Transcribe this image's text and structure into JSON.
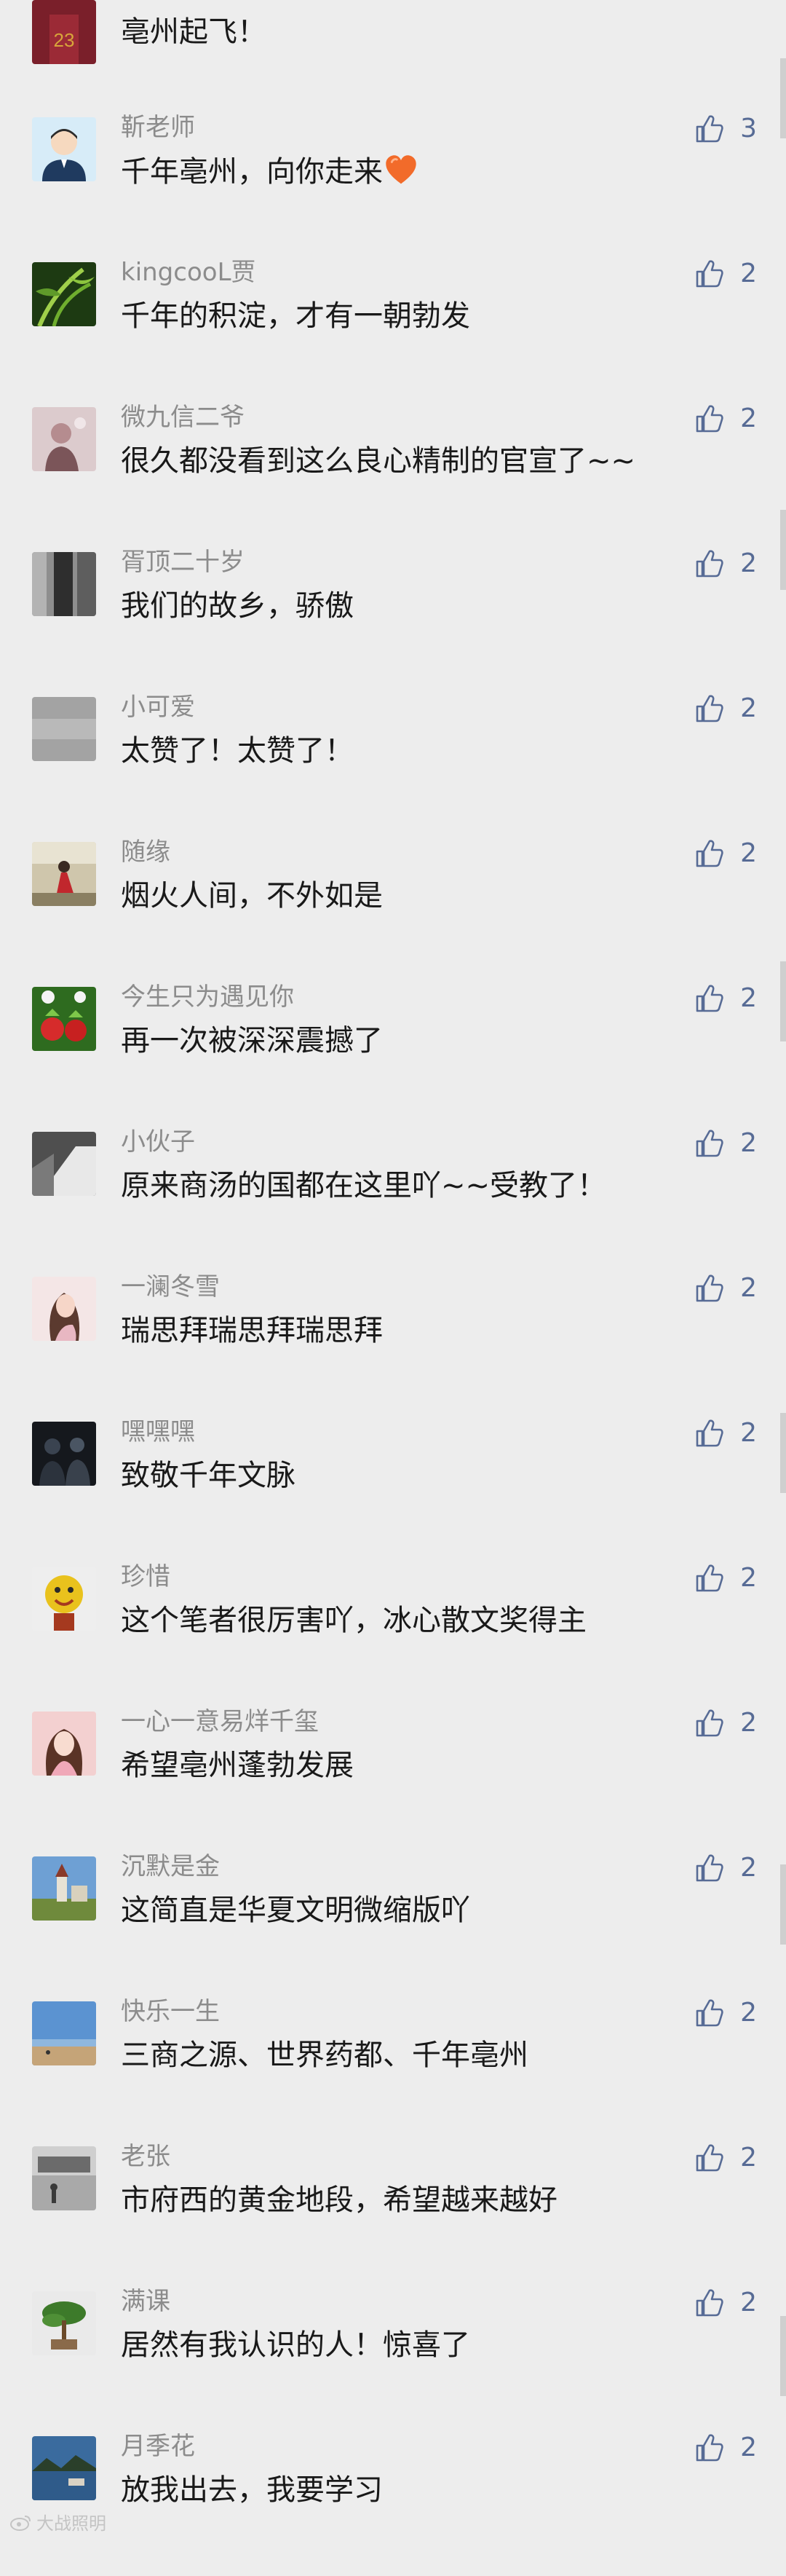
{
  "comments": [
    {
      "name": "",
      "text": "亳州起飞！",
      "likes": "",
      "avatar": "avatar-basketball-jersey",
      "colors": [
        "#7a1f2a",
        "#d8a53a"
      ]
    },
    {
      "name": "靳老师",
      "text": "千年亳州，向你走来",
      "emoji": "heart-emoji",
      "likes": "3",
      "avatar": "avatar-cartoon-teacher",
      "colors": [
        "#cfe6f4",
        "#1f3a5f"
      ]
    },
    {
      "name": "kingcooL贾",
      "text": "千年的积淀，才有一朝勃发",
      "likes": "2",
      "avatar": "avatar-bamboo",
      "colors": [
        "#2f5a1c",
        "#9fcf4a"
      ]
    },
    {
      "name": "微九信二爷",
      "text": "很久都没看到这么良心精制的官宣了~~",
      "likes": "2",
      "avatar": "avatar-pink-portrait",
      "colors": [
        "#d8c6c9",
        "#6f4a4f"
      ]
    },
    {
      "name": "胥顶二十岁",
      "text": "我们的故乡，骄傲",
      "likes": "2",
      "avatar": "avatar-dark-room",
      "colors": [
        "#3a3a3a",
        "#8e8e8e"
      ]
    },
    {
      "name": "小可爱",
      "text": "太赞了！太赞了！",
      "likes": "2",
      "avatar": "avatar-grey-blank",
      "colors": [
        "#9a9a9a",
        "#b5b5b5"
      ]
    },
    {
      "name": "随缘",
      "text": "烟火人间，不外如是",
      "likes": "2",
      "avatar": "avatar-red-dress",
      "colors": [
        "#c9c0a6",
        "#c1272d"
      ]
    },
    {
      "name": "今生只为遇见你",
      "text": "再一次被深深震撼了",
      "likes": "2",
      "avatar": "avatar-strawberries",
      "colors": [
        "#2e6b1f",
        "#d62b2b"
      ]
    },
    {
      "name": "小伙子",
      "text": "原来商汤的国都在这里吖~~受教了！",
      "likes": "2",
      "avatar": "avatar-light-window",
      "colors": [
        "#5a5a5a",
        "#e8e8e8"
      ]
    },
    {
      "name": "一澜冬雪",
      "text": "瑞思拜瑞思拜瑞思拜",
      "likes": "2",
      "avatar": "avatar-girl-portrait",
      "colors": [
        "#f1dede",
        "#5b3a2f"
      ]
    },
    {
      "name": "嘿嘿嘿",
      "text": "致敬千年文脉",
      "likes": "2",
      "avatar": "avatar-night-people",
      "colors": [
        "#15181d",
        "#4a5563"
      ]
    },
    {
      "name": "珍惜",
      "text": "这个笔者很厉害吖，冰心散文奖得主",
      "likes": "2",
      "avatar": "avatar-smiley-toy",
      "colors": [
        "#e9c21d",
        "#a5391f"
      ]
    },
    {
      "name": "一心一意易烊千玺",
      "text": "希望亳州蓬勃发展",
      "likes": "2",
      "avatar": "avatar-pink-girl",
      "colors": [
        "#f3c7c7",
        "#5a3326"
      ]
    },
    {
      "name": "沉默是金",
      "text": "这简直是华夏文明微缩版吖",
      "likes": "2",
      "avatar": "avatar-castle",
      "colors": [
        "#5e93c8",
        "#7a8f4a"
      ]
    },
    {
      "name": "快乐一生",
      "text": "三商之源、世界药都、千年亳州",
      "likes": "2",
      "avatar": "avatar-beach",
      "colors": [
        "#4f86c7",
        "#c5a478"
      ]
    },
    {
      "name": "老张",
      "text": "市府西的黄金地段，希望越来越好",
      "likes": "2",
      "avatar": "avatar-street-scene",
      "colors": [
        "#c7c7c7",
        "#6b6b6b"
      ]
    },
    {
      "name": "满课",
      "text": "居然有我认识的人！惊喜了",
      "likes": "2",
      "avatar": "avatar-bonsai",
      "colors": [
        "#e7e7e7",
        "#3d7a2a"
      ]
    },
    {
      "name": "月季花",
      "text": "放我出去，我要学习",
      "likes": "2",
      "avatar": "avatar-harbor",
      "colors": [
        "#2f5b8a",
        "#d9d2c4"
      ]
    }
  ],
  "watermark": {
    "text": "大战照明",
    "icon": "weibo-icon"
  },
  "like_color": "#576b95"
}
